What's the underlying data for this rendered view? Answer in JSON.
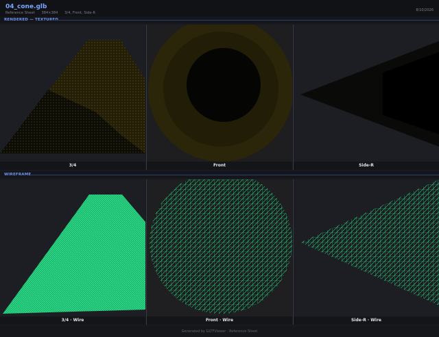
{
  "header": {
    "title": "04_cone.glb",
    "subtitle": "Reference Sheet",
    "resolution": "384×384",
    "views": "3/4, Front, Side-R",
    "date": "8/10/2026"
  },
  "sections": {
    "rendered": "RENDERED — TEXTURED",
    "wireframe": "WIREFRAME"
  },
  "rendered_labels": [
    "3/4",
    "Front",
    "Side-R"
  ],
  "wire_labels": [
    "3/4 · Wire",
    "Front · Wire",
    "Side-R · Wire"
  ],
  "footer": "Generated by GLTFViewer · Reference Sheet",
  "colors": {
    "accent": "#7aa6ff",
    "texture": "#2a2408",
    "wire": "#2fe08a"
  }
}
